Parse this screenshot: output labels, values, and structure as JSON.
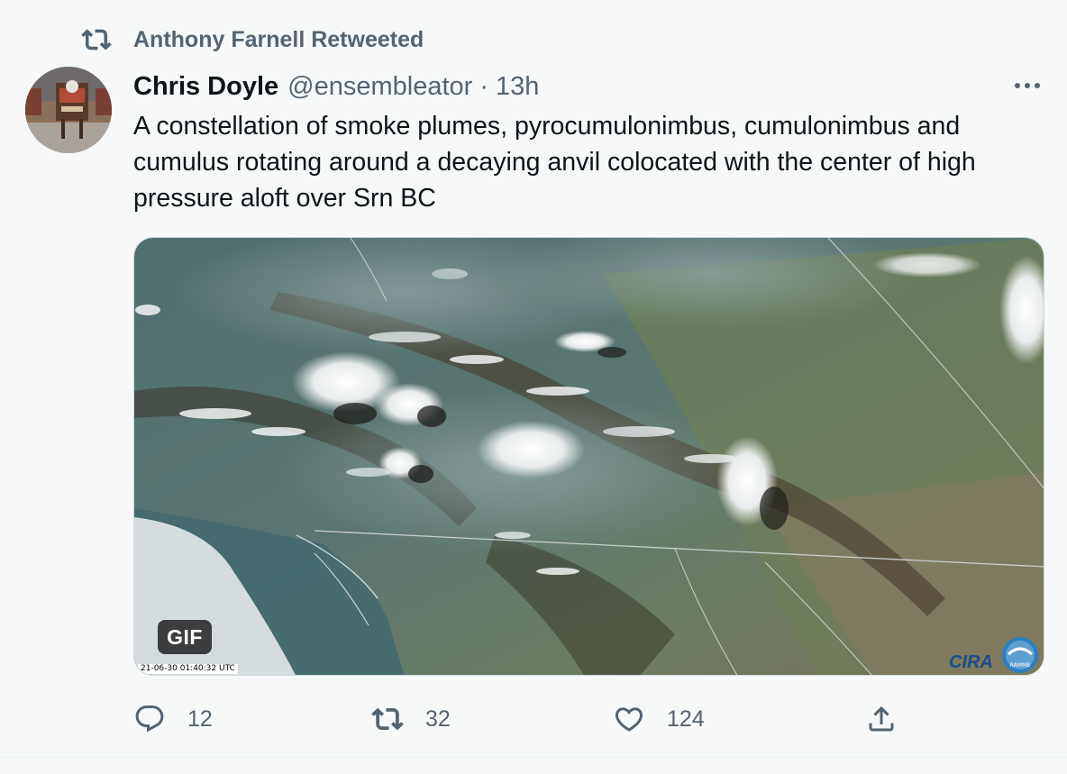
{
  "retweet_header": {
    "icon": "retweet-icon",
    "text": "Anthony Farnell Retweeted"
  },
  "author": {
    "display_name": "Chris Doyle",
    "handle": "@ensembleator",
    "separator": "·",
    "time": "13h"
  },
  "more_menu": {
    "icon": "more-horizontal-icon"
  },
  "tweet_text": "A constellation of smoke plumes, pyrocumulonimbus, cumulonimbus and cumulus rotating around a decaying anvil colocated with the center of high pressure aloft over Srn BC",
  "media": {
    "badge": "GIF",
    "timestamp": "21-06-30 01:40:32 UTC",
    "logo_text": "CIRA",
    "logo2_text": "RAMMB"
  },
  "actions": {
    "reply": {
      "icon": "reply-icon",
      "count": "12"
    },
    "retweet": {
      "icon": "retweet-icon",
      "count": "32"
    },
    "like": {
      "icon": "heart-icon",
      "count": "124"
    },
    "share": {
      "icon": "share-icon"
    }
  },
  "colors": {
    "background": "#f7f9f9",
    "primary_text": "#0f1419",
    "secondary_text": "#536471"
  }
}
